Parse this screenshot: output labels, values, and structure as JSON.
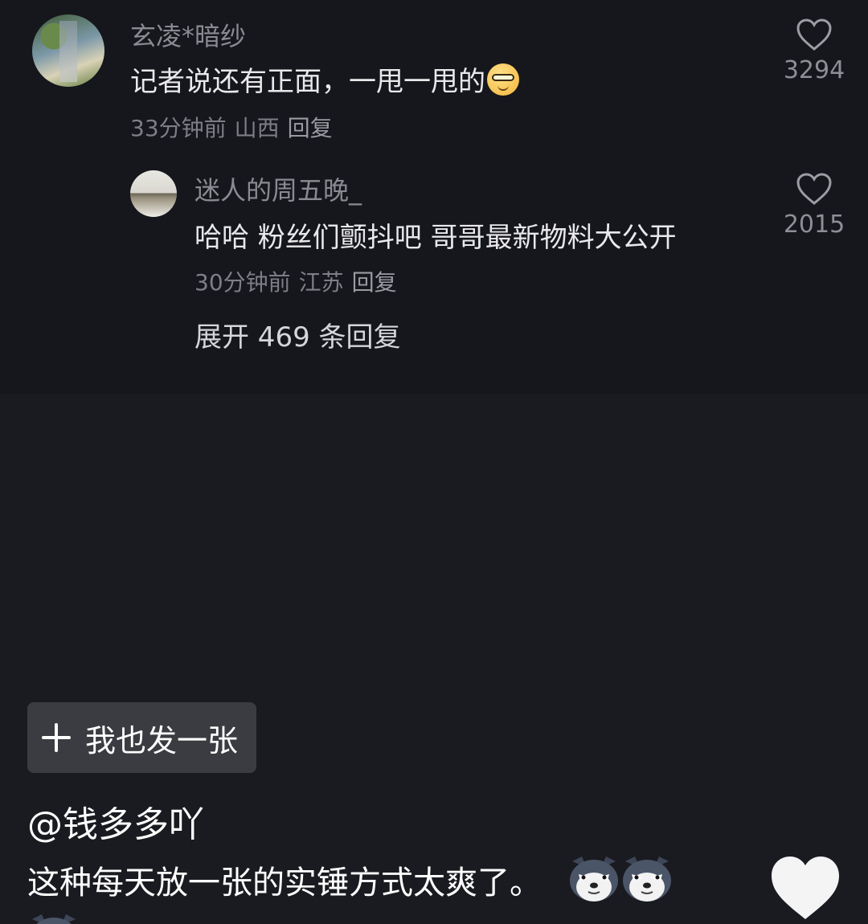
{
  "comments": {
    "main": {
      "username": "玄凌*暗纱",
      "text": "记者说还有正面，一甩一甩的",
      "emoji": "smile-sunglasses",
      "time": "33分钟前",
      "location": "山西",
      "reply_label": "回复",
      "likes": "3294"
    },
    "reply": {
      "username": "迷人的周五晚_",
      "text": "哈哈 粉丝们颤抖吧 哥哥最新物料大公开",
      "time": "30分钟前",
      "location": "江苏",
      "reply_label": "回复",
      "likes": "2015"
    },
    "expand_label": "展开 469 条回复"
  },
  "post": {
    "add_button_label": "我也发一张",
    "author": "@钱多多吖",
    "caption": "这种每天放一张的实锤方式太爽了。",
    "caption_emojis": [
      "wolf-emoji",
      "wolf-emoji",
      "wolf-emoji"
    ]
  },
  "icons": {
    "comment_like": "heart-outline-icon",
    "post_like": "heart-filled-icon",
    "add": "plus-icon"
  },
  "colors": {
    "panel_bg": "#16171c",
    "page_bg": "#1a1b20",
    "muted_text": "#8a8b92",
    "button_bg": "#3b3c42"
  }
}
